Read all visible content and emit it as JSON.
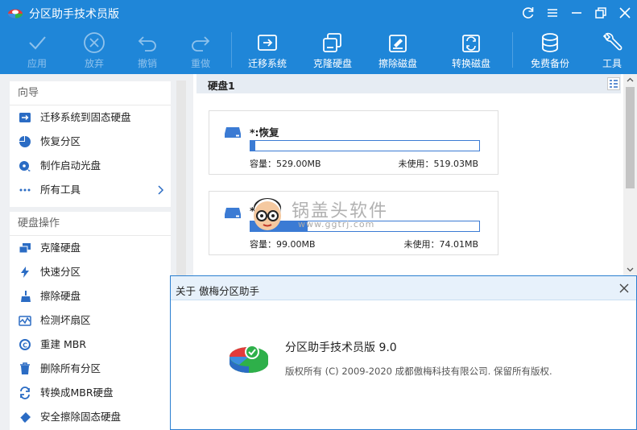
{
  "window": {
    "title": "分区助手技术员版"
  },
  "toolbar": {
    "items": [
      {
        "label": "应用",
        "icon": "check-icon",
        "enabled": false
      },
      {
        "label": "放弃",
        "icon": "cancel-icon",
        "enabled": false
      },
      {
        "label": "撤销",
        "icon": "undo-icon",
        "enabled": false
      },
      {
        "label": "重做",
        "icon": "redo-icon",
        "enabled": false
      },
      {
        "label": "迁移系统",
        "icon": "migrate-os-icon",
        "enabled": true
      },
      {
        "label": "克隆硬盘",
        "icon": "clone-disk-icon",
        "enabled": true
      },
      {
        "label": "擦除磁盘",
        "icon": "wipe-disk-icon",
        "enabled": true
      },
      {
        "label": "转换磁盘",
        "icon": "convert-disk-icon",
        "enabled": true
      },
      {
        "label": "免费备份",
        "icon": "backup-icon",
        "enabled": true
      },
      {
        "label": "工具",
        "icon": "tools-icon",
        "enabled": true
      }
    ]
  },
  "wizard": {
    "title": "向导",
    "items": [
      {
        "label": "迁移系统到固态硬盘",
        "icon": "migrate-ssd-icon"
      },
      {
        "label": "恢复分区",
        "icon": "restore-partition-icon"
      },
      {
        "label": "制作启动光盘",
        "icon": "bootable-media-icon"
      },
      {
        "label": "所有工具",
        "icon": "more-icon"
      }
    ]
  },
  "disk_ops": {
    "title": "硬盘操作",
    "items": [
      {
        "label": "克隆硬盘",
        "icon": "clone-disk-icon"
      },
      {
        "label": "快速分区",
        "icon": "lightning-icon"
      },
      {
        "label": "擦除硬盘",
        "icon": "broom-icon"
      },
      {
        "label": "检测坏扇区",
        "icon": "bad-sector-icon"
      },
      {
        "label": "重建 MBR",
        "icon": "rebuild-mbr-icon"
      },
      {
        "label": "删除所有分区",
        "icon": "trash-icon"
      },
      {
        "label": "转换成MBR硬盘",
        "icon": "convert-icon"
      },
      {
        "label": "安全擦除固态硬盘",
        "icon": "eraser-icon"
      }
    ]
  },
  "disk": {
    "label": "硬盘1",
    "partitions": [
      {
        "name": "*:恢复",
        "capacity": "容量：529.00MB",
        "free": "未使用：519.03MB",
        "used_fraction": 0.02
      },
      {
        "name": "*:",
        "capacity": "容量：99.00MB",
        "free": "未使用：74.01MB",
        "used_fraction": 0.25
      }
    ]
  },
  "watermark": {
    "text": "锅盖头软件",
    "url": "www.ggtrj.com"
  },
  "about": {
    "title": "关于 傲梅分区助手",
    "product": "分区助手技术员版 9.0",
    "copyright": "版权所有 (C) 2009-2020 成都傲梅科技有限公司. 保留所有版权."
  },
  "colors": {
    "titlebar": "#1f86d8",
    "accent": "#3b7bd4",
    "disabled_label": "#8fc2ec"
  }
}
